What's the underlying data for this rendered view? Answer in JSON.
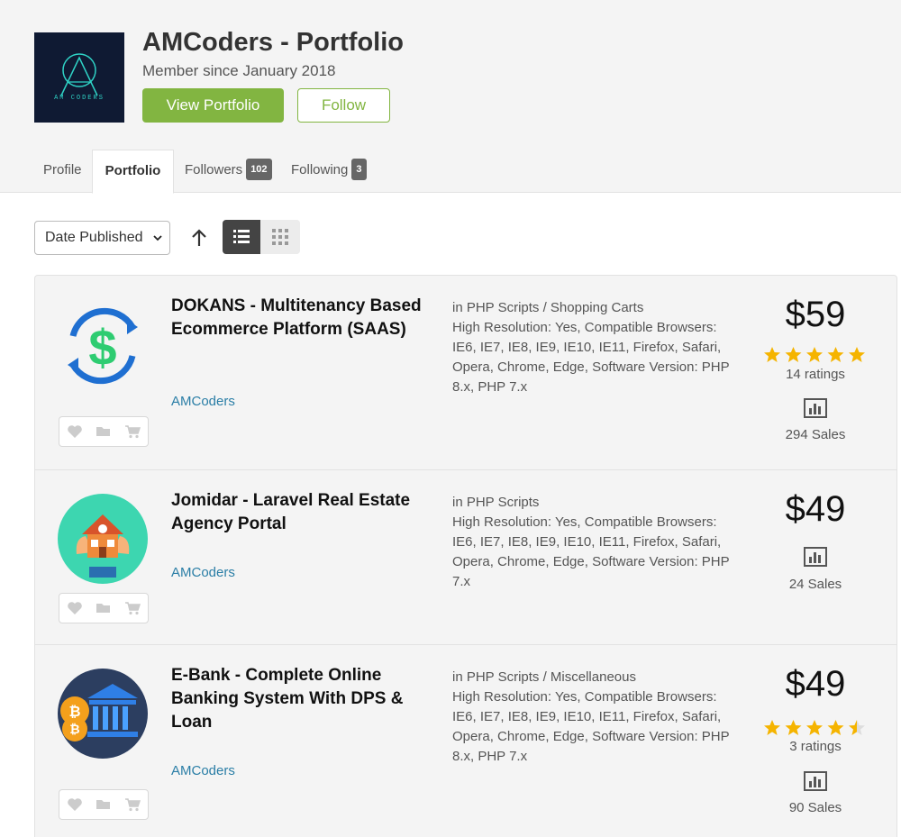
{
  "profile": {
    "title": "AMCoders - Portfolio",
    "member_since": "Member since January 2018",
    "logo_text": "AM CODERS",
    "view_portfolio_label": "View Portfolio",
    "follow_label": "Follow"
  },
  "tabs": [
    {
      "label": "Profile"
    },
    {
      "label": "Portfolio",
      "active": true
    },
    {
      "label": "Followers",
      "count": "102"
    },
    {
      "label": "Following",
      "count": "3"
    }
  ],
  "toolbar": {
    "sort_selected": "Date Published",
    "sort_direction_icon": "arrow-up-icon",
    "view_modes": [
      "list-view-icon",
      "grid-view-icon"
    ],
    "active_view": "list"
  },
  "items": [
    {
      "title": "DOKANS - Multitenancy Based Ecommerce Platform (SAAS)",
      "author": "AMCoders",
      "category": "in PHP Scripts / Shopping Carts",
      "attributes": "High Resolution: Yes, Compatible Browsers: IE6, IE7, IE8, IE9, IE10, IE11, Firefox, Safari, Opera, Chrome, Edge, Software Version: PHP 8.x, PHP 7.x",
      "price": "$59",
      "rating": 5,
      "ratings_text": "14 ratings",
      "sales": "294 Sales",
      "thumb_icon": "dollar-cycle-icon"
    },
    {
      "title": "Jomidar - Laravel Real Estate Agency Portal",
      "author": "AMCoders",
      "category": "in PHP Scripts",
      "attributes": "High Resolution: Yes, Compatible Browsers: IE6, IE7, IE8, IE9, IE10, IE11, Firefox, Safari, Opera, Chrome, Edge, Software Version: PHP 7.x",
      "price": "$49",
      "rating": null,
      "ratings_text": "",
      "sales": "24 Sales",
      "thumb_icon": "house-in-hands-icon"
    },
    {
      "title": "E-Bank - Complete Online Banking System With DPS & Loan",
      "author": "AMCoders",
      "category": "in PHP Scripts / Miscellaneous",
      "attributes": "High Resolution: Yes, Compatible Browsers: IE6, IE7, IE8, IE9, IE10, IE11, Firefox, Safari, Opera, Chrome, Edge, Software Version: PHP 8.x, PHP 7.x",
      "price": "$49",
      "rating": 4.5,
      "ratings_text": "3 ratings",
      "sales": "90 Sales",
      "thumb_icon": "bank-bitcoin-icon"
    }
  ],
  "colors": {
    "accent_green": "#82b541",
    "link_blue": "#2a7ea6",
    "star_yellow": "#f5b400"
  }
}
